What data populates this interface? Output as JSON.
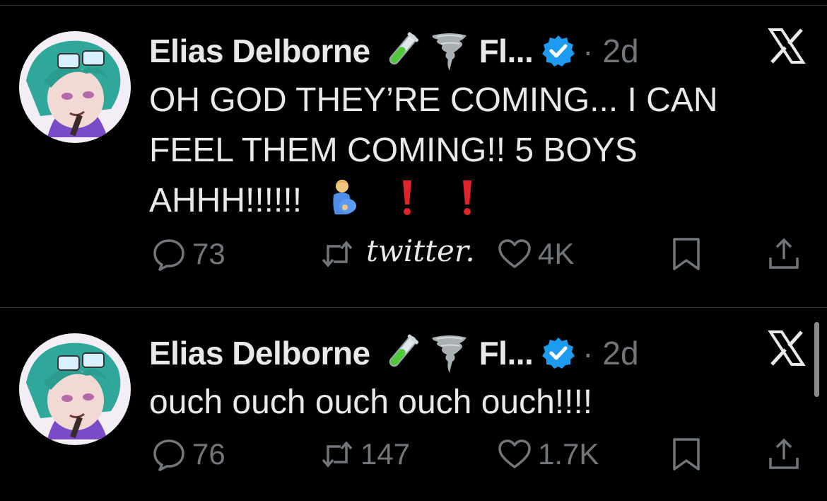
{
  "tweets": [
    {
      "author_name": "Elias Delborne",
      "author_emojis": [
        "test-tube-emoji",
        "tornado-emoji"
      ],
      "handle_truncated": "Fl...",
      "verified": true,
      "time": "· 2d",
      "text_lines": [
        "OH GOD THEY’RE COMING... I CAN",
        "FEEL THEM COMING!! 5 BOYS",
        "AHHH!!!!!!"
      ],
      "replies": "73",
      "reposts": "",
      "likes": "4K"
    },
    {
      "author_name": "Elias Delborne",
      "author_emojis": [
        "test-tube-emoji",
        "tornado-emoji"
      ],
      "handle_truncated": "Fl...",
      "verified": true,
      "time": "· 2d",
      "text_lines": [
        "ouch ouch ouch ouch ouch!!!!"
      ],
      "replies": "76",
      "reposts": "147",
      "likes": "1.7K"
    }
  ],
  "watermark": "twitter.",
  "colors": {
    "background": "#000000",
    "text": "#e7e9ea",
    "muted": "#71767b",
    "verified": "#1d9bf0",
    "exclaim": "#e0242b"
  }
}
